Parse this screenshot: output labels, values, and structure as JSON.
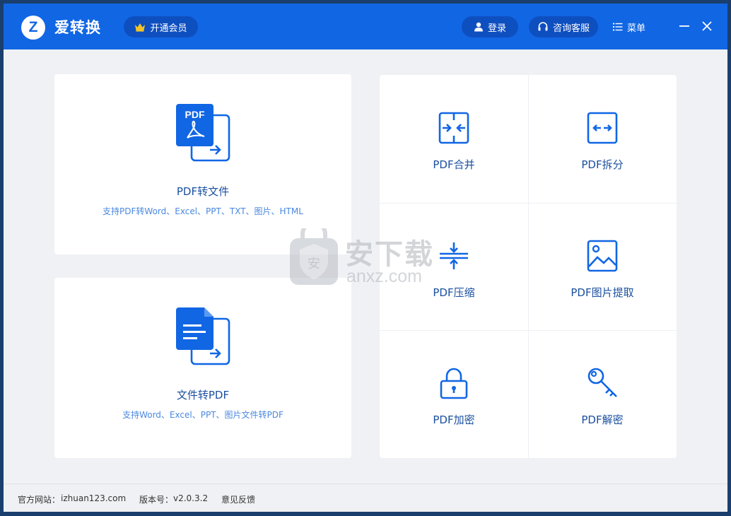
{
  "app": {
    "logo_letter": "Z",
    "title": "爱转换",
    "vip_label": "开通会员",
    "login_label": "登录",
    "service_label": "咨询客服",
    "menu_label": "菜单"
  },
  "main_cards": [
    {
      "title": "PDF转文件",
      "subtitle": "支持PDF转Word、Excel、PPT、TXT、图片、HTML",
      "icon_text": "PDF"
    },
    {
      "title": "文件转PDF",
      "subtitle": "支持Word、Excel、PPT、图片文件转PDF"
    }
  ],
  "tools": [
    {
      "label": "PDF合并",
      "icon": "merge-icon"
    },
    {
      "label": "PDF拆分",
      "icon": "split-icon"
    },
    {
      "label": "PDF压缩",
      "icon": "compress-icon"
    },
    {
      "label": "PDF图片提取",
      "icon": "image-icon"
    },
    {
      "label": "PDF加密",
      "icon": "lock-icon"
    },
    {
      "label": "PDF解密",
      "icon": "key-icon"
    }
  ],
  "watermark": {
    "cn": "安下载",
    "en": "anxz.com"
  },
  "status": {
    "website_label": "官方网站：",
    "website": "izhuan123.com",
    "version_label": "版本号：",
    "version": "v2.0.3.2",
    "feedback": "意见反馈"
  },
  "colors": {
    "brand": "#1166e4",
    "pill": "#0e4fc0",
    "accent_text": "#1a4f9f",
    "subtitle": "#4a88e0",
    "crown": "#f5c228"
  }
}
